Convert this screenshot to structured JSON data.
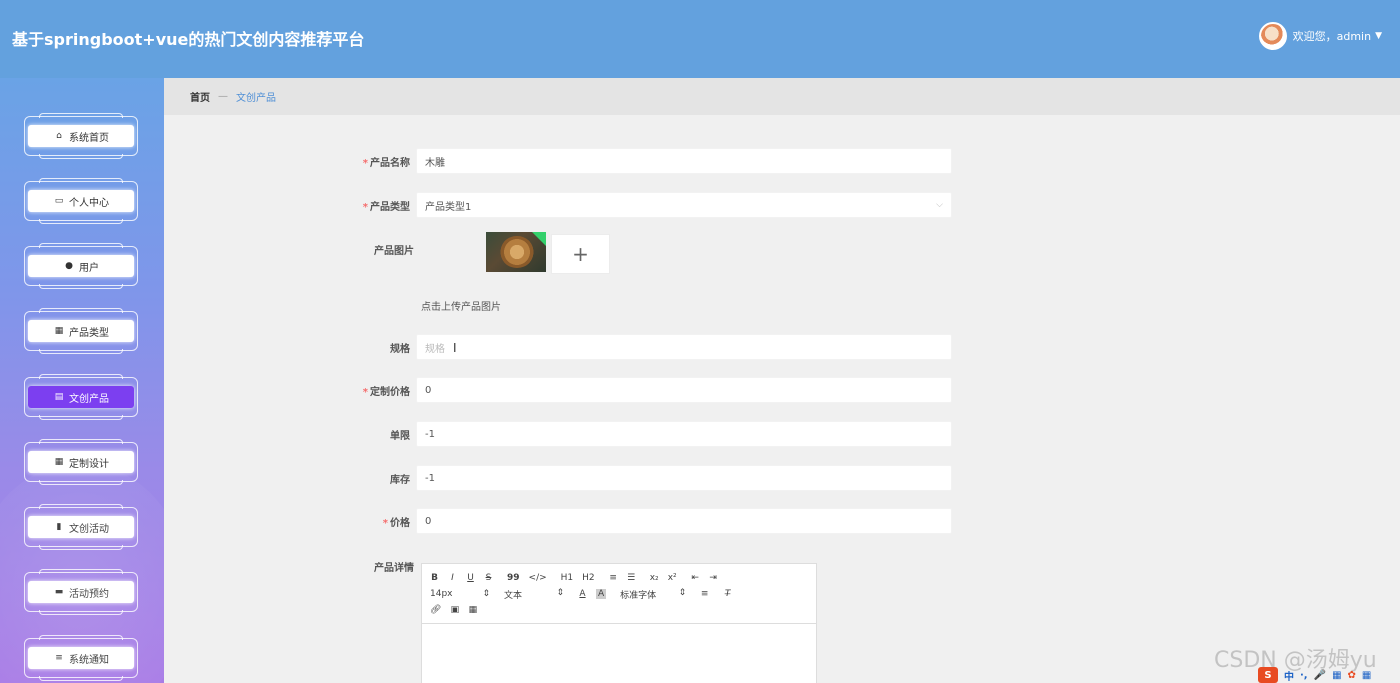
{
  "header": {
    "title": "基于springboot+vue的热门文创内容推荐平台",
    "welcome": "欢迎您，admin"
  },
  "sidebar": {
    "items": [
      {
        "label": "系统首页",
        "icon": "home-icon",
        "glyph": "⌂",
        "active": false
      },
      {
        "label": "个人中心",
        "icon": "id-card-icon",
        "glyph": "▭",
        "active": false
      },
      {
        "label": "用户",
        "icon": "user-icon",
        "glyph": "●",
        "active": false
      },
      {
        "label": "产品类型",
        "icon": "grid-icon",
        "glyph": "▦",
        "active": false
      },
      {
        "label": "文创产品",
        "icon": "document-icon",
        "glyph": "▤",
        "active": true
      },
      {
        "label": "定制设计",
        "icon": "grid-icon",
        "glyph": "▦",
        "active": false
      },
      {
        "label": "文创活动",
        "icon": "bar-chart-icon",
        "glyph": "▮",
        "active": false
      },
      {
        "label": "活动预约",
        "icon": "chat-icon",
        "glyph": "▬",
        "active": false
      },
      {
        "label": "系统通知",
        "icon": "list-icon",
        "glyph": "≡",
        "active": false
      }
    ]
  },
  "breadcrumb": {
    "home": "首页",
    "separator": "—",
    "current": "文创产品"
  },
  "form": {
    "product_name": {
      "label": "产品名称",
      "required": true,
      "value": "木雕"
    },
    "product_type": {
      "label": "产品类型",
      "required": true,
      "value": "产品类型1"
    },
    "product_image": {
      "label": "产品图片",
      "upload_hint": "点击上传产品图片",
      "add_glyph": "+"
    },
    "spec": {
      "label": "规格",
      "required": false,
      "placeholder": "规格"
    },
    "custom_price": {
      "label": "定制价格",
      "required": true,
      "value": "0"
    },
    "order_limit": {
      "label": "单限",
      "required": false,
      "value": "-1"
    },
    "stock": {
      "label": "库存",
      "required": false,
      "value": "-1"
    },
    "price": {
      "label": "价格",
      "required": true,
      "value": "0"
    },
    "details": {
      "label": "产品详情"
    }
  },
  "editor": {
    "row1": [
      "B",
      "I",
      "U",
      "S",
      "99",
      "</>",
      "H1",
      "H2",
      "≡",
      "☰",
      "x₂",
      "x²",
      "⇤",
      "⇥"
    ],
    "font_size": "14px",
    "text_type": "文本",
    "font_family": "标准字体"
  },
  "watermark": "CSDN @汤姆yu",
  "tray": {
    "logo": "S",
    "items": [
      "中",
      "·,",
      "🎤",
      "▦",
      "✿",
      "▦"
    ]
  },
  "colors": {
    "header": "#63a1de",
    "active_menu": "#7c3ff0",
    "accent": "#4f8fd6"
  }
}
